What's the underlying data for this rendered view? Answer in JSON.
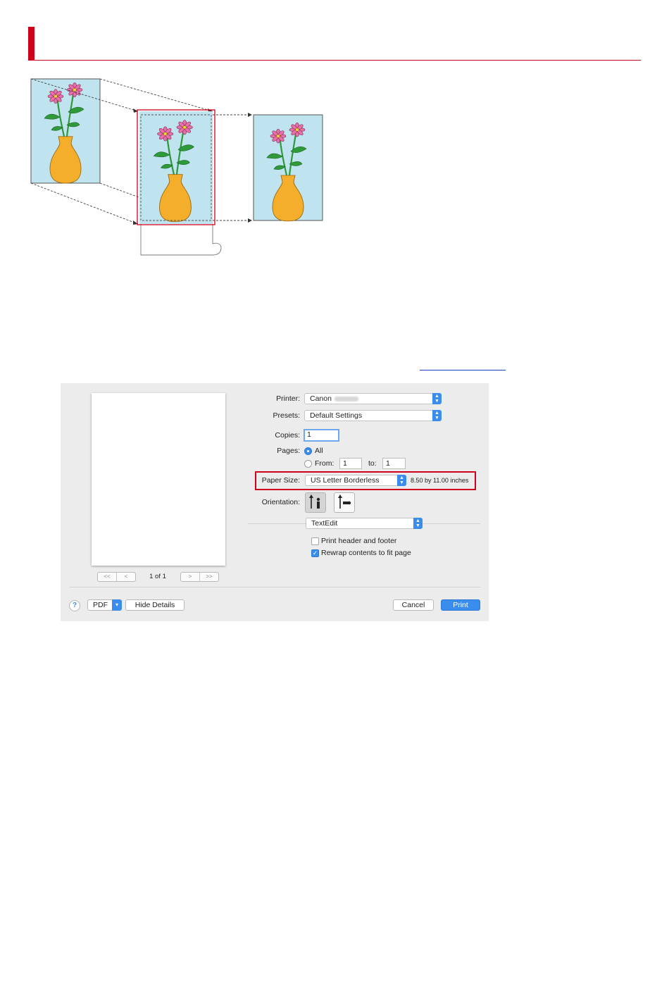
{
  "dialog": {
    "printer_label": "Printer:",
    "printer_value": "Canon",
    "presets_label": "Presets:",
    "presets_value": "Default Settings",
    "copies_label": "Copies:",
    "copies_value": "1",
    "pages_label": "Pages:",
    "pages_all": "All",
    "pages_from": "From:",
    "pages_from_value": "1",
    "pages_to": "to:",
    "pages_to_value": "1",
    "paper_size_label": "Paper Size:",
    "paper_size_value": "US Letter Borderless",
    "paper_size_dims": "8.50 by 11.00 inches",
    "orientation_label": "Orientation:",
    "app_section": "TextEdit",
    "option_header_footer": "Print header and footer",
    "option_rewrap": "Rewrap contents to fit page",
    "preview_page_count": "1 of 1",
    "nav_first": "<<",
    "nav_prev": "<",
    "nav_next": ">",
    "nav_last": ">>",
    "help_label": "?",
    "pdf_label": "PDF",
    "hide_details_label": "Hide Details",
    "cancel_label": "Cancel",
    "print_label": "Print"
  },
  "colors": {
    "accent_red": "#d0021b",
    "mac_blue": "#3b8ded",
    "paper_blue": "#bfe3ef",
    "vase_orange": "#f4ae2c",
    "flower_pink": "#e86fa8",
    "leaf_green": "#2e9a3a"
  }
}
